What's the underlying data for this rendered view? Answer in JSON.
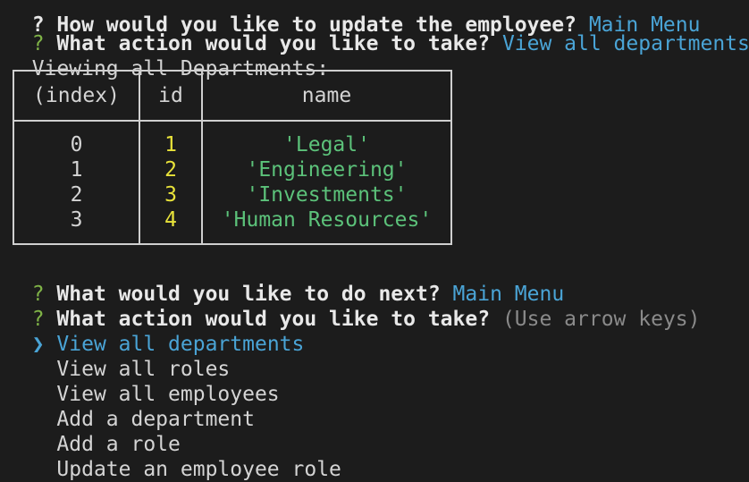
{
  "terminal": {
    "lines": {
      "cut_prompt": "? How would you like to update the employee? ",
      "cut_answer": "Main Menu",
      "q1_mark": "?",
      "q1_text": "What action would you like to take?",
      "q1_answer": "View all departments",
      "viewing": "Viewing all Departments:",
      "q2_mark": "?",
      "q2_text": "What would you like to do next?",
      "q2_answer": "Main Menu",
      "q3_mark": "?",
      "q3_text": "What action would you like to take?",
      "q3_hint": "(Use arrow keys)"
    },
    "table": {
      "headers": [
        "(index)",
        "id",
        "name"
      ],
      "rows": [
        {
          "index": "0",
          "id": "1",
          "name": "'Legal'"
        },
        {
          "index": "1",
          "id": "2",
          "name": "'Engineering'"
        },
        {
          "index": "2",
          "id": "3",
          "name": "'Investments'"
        },
        {
          "index": "3",
          "id": "4",
          "name": "'Human Resources'"
        }
      ]
    },
    "menu": {
      "pointer": "❯",
      "selected_index": 0,
      "options": [
        "View all departments",
        "View all roles",
        "View all employees",
        "Add a department",
        "Add a role",
        "Update an employee role"
      ]
    },
    "colors": {
      "background": "#1c1c1c",
      "question_mark": "#7fb347",
      "answer": "#4aa4d6",
      "id_values": "#e8e23a",
      "name_values": "#5cc27a",
      "hint": "#8a8a8a"
    }
  }
}
